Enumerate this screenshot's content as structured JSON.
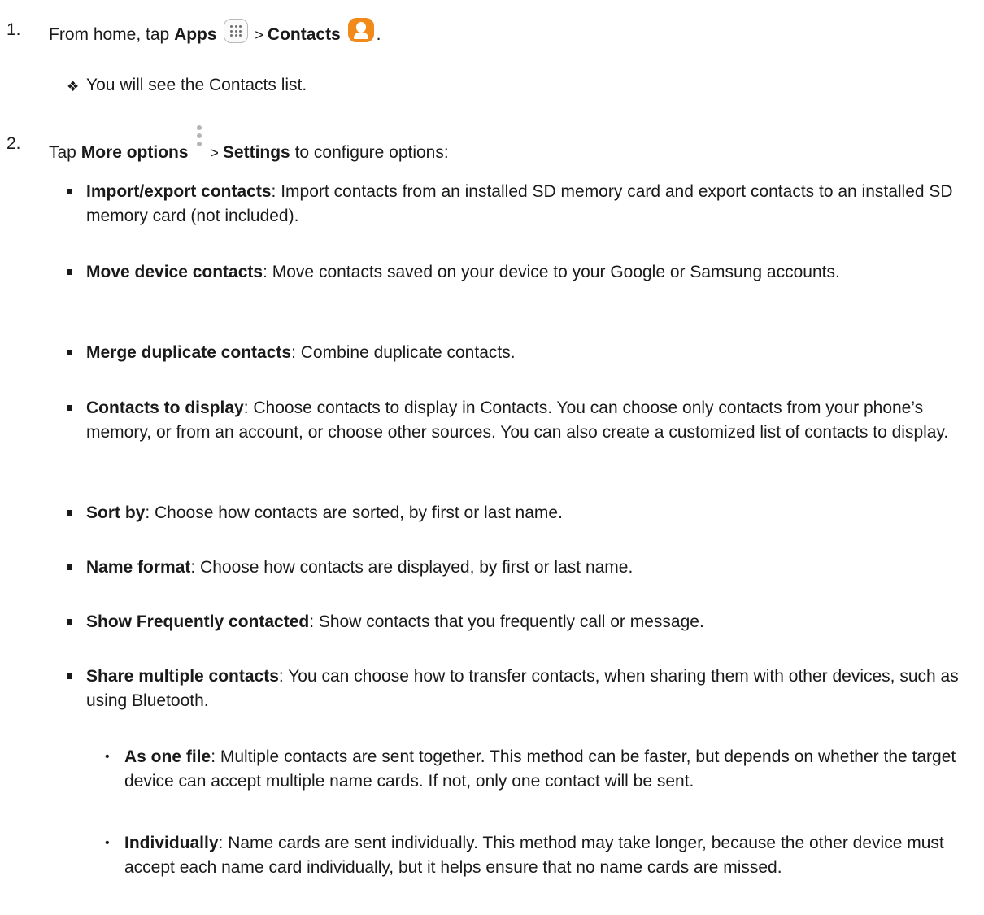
{
  "steps": [
    {
      "number": "1.",
      "prefix": "From home, tap ",
      "bold1": "Apps",
      "sep": " > ",
      "bold2": "Contacts",
      "suffix": ".",
      "icons": [
        "apps-grid-icon",
        "contacts-icon"
      ],
      "note": "You will see the Contacts list."
    },
    {
      "number": "2.",
      "prefix": "Tap ",
      "bold1": "More options",
      "sep": " > ",
      "bold2": "Settings",
      "suffix": " to configure options:",
      "icons": [
        "more-options-icon"
      ]
    }
  ],
  "options": [
    {
      "term": "Import/export contacts",
      "desc": ": Import contacts from an installed SD memory card and export contacts to an installed SD memory card (not included)."
    },
    {
      "term": "Move device contacts",
      "desc": ": Move contacts saved on your device to your Google or Samsung accounts."
    },
    {
      "term": "Merge duplicate contacts",
      "desc": ": Combine duplicate contacts."
    },
    {
      "term": "Contacts to display",
      "desc": ": Choose contacts to display in Contacts. You can choose only contacts from your phone’s memory, or from an account, or choose other sources. You can also create a customized list of contacts to display."
    },
    {
      "term": "Sort by",
      "desc": ": Choose how contacts are sorted, by first or last name."
    },
    {
      "term": "Name format",
      "desc": ": Choose how contacts are displayed, by first or last name."
    },
    {
      "term": "Show Frequently contacted",
      "desc": ": Show contacts that you frequently call or message."
    },
    {
      "term": "Share multiple contacts",
      "desc": ": You can choose how to transfer contacts, when sharing them with other devices, such as using Bluetooth."
    }
  ],
  "sub_options": [
    {
      "term": "As one file",
      "desc": ": Multiple contacts are sent together. This method can be faster, but depends on whether the target device can accept multiple name cards. If not, only one contact will be sent."
    },
    {
      "term": "Individually",
      "desc": ": Name cards are sent individually. This method may take longer, because the other device must accept each name card individually, but it helps ensure that no name cards are missed."
    }
  ]
}
